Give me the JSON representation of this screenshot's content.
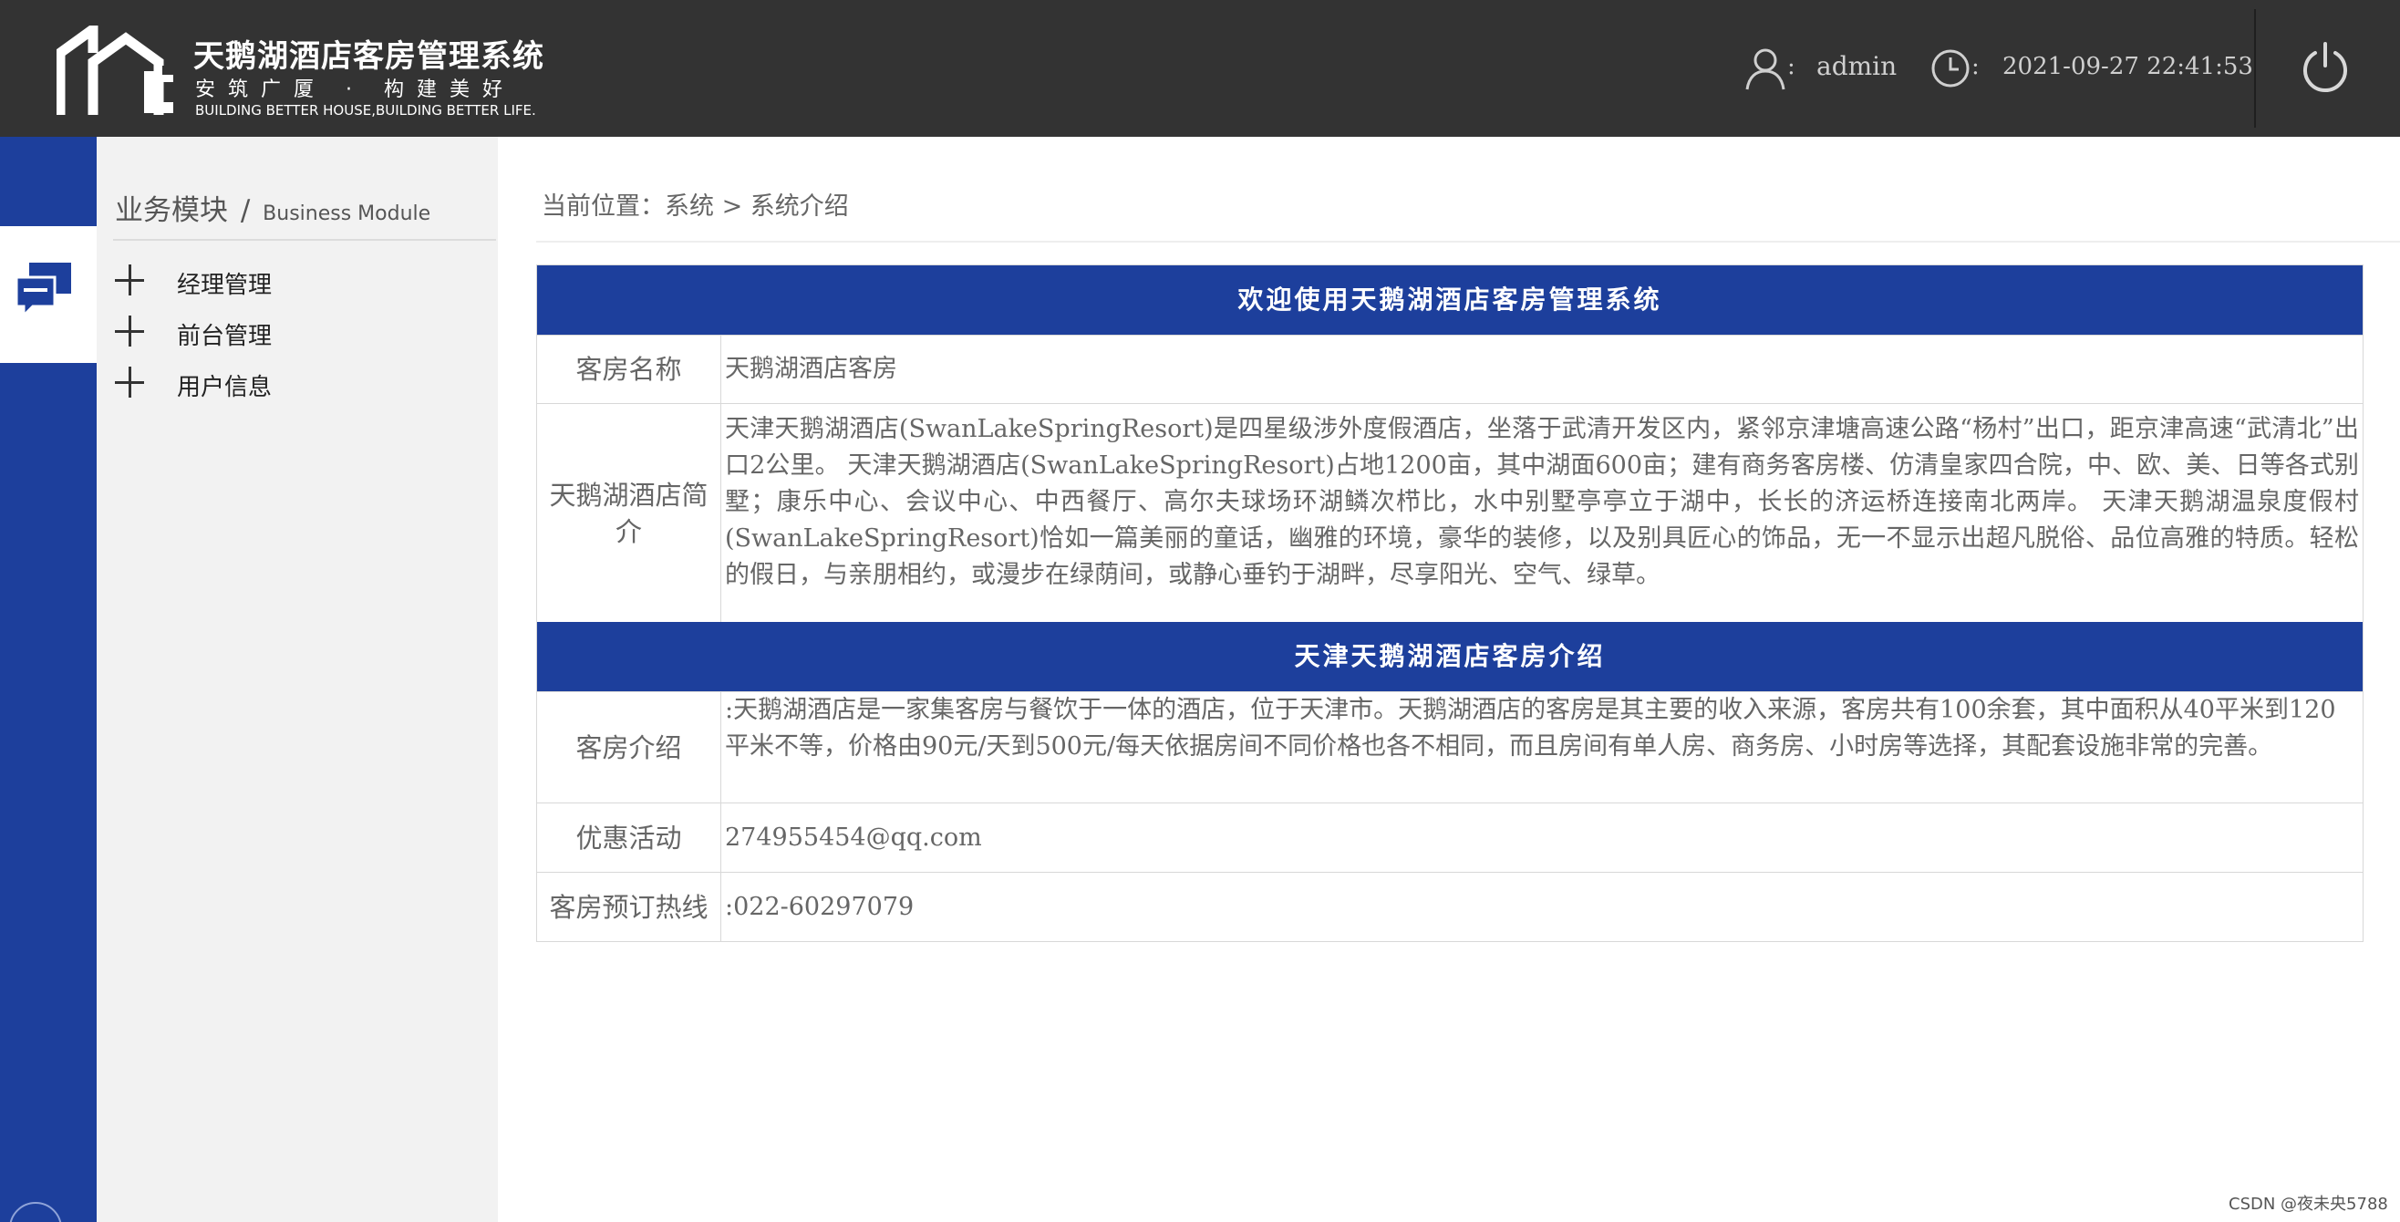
{
  "header": {
    "logo_title": "天鹅湖酒店客房管理系统",
    "logo_slogan": "安筑广厦 · 构建美好",
    "logo_slogan_en": "BUILDING BETTER HOUSE,BUILDING BETTER LIFE.",
    "user_icon": "user-icon",
    "colon": ":",
    "username": "admin",
    "clock_icon": "clock-icon",
    "datetime": "2021-09-27 22:41:53",
    "power_icon": "power-icon"
  },
  "leftbar": {
    "active_icon": "chat-icon"
  },
  "sidebar": {
    "module_title": "业务模块",
    "module_sep": "/",
    "module_title_en": "Business Module",
    "items": [
      {
        "label": "经理管理",
        "icon": "plus-icon"
      },
      {
        "label": "前台管理",
        "icon": "plus-icon"
      },
      {
        "label": "用户信息",
        "icon": "plus-icon"
      }
    ]
  },
  "breadcrumb": "当前位置：系统 > 系统介绍",
  "panel": {
    "welcome_title": "欢迎使用天鹅湖酒店客房管理系统",
    "rows_top": [
      {
        "label": "客房名称",
        "value": "天鹅湖酒店客房"
      },
      {
        "label": "天鹅湖酒店简介",
        "value": "天津天鹅湖酒店(SwanLakeSpringResort)是四星级涉外度假酒店，坐落于武清开发区内，紧邻京津塘高速公路“杨村”出口，距京津高速“武清北”出口2公里。 天津天鹅湖酒店(SwanLakeSpringResort)占地1200亩，其中湖面600亩；建有商务客房楼、仿清皇家四合院，中、欧、美、日等各式别墅；康乐中心、会议中心、中西餐厅、高尔夫球场环湖鳞次栉比，水中别墅亭亭立于湖中，长长的济运桥连接南北两岸。 天津天鹅湖温泉度假村(SwanLakeSpringResort)恰如一篇美丽的童话，幽雅的环境，豪华的装修，以及别具匠心的饰品，无一不显示出超凡脱俗、品位高雅的特质。轻松的假日，与亲朋相约，或漫步在绿荫间，或静心垂钓于湖畔，尽享阳光、空气、绿草。"
      }
    ],
    "section_title": "天津天鹅湖酒店客房介绍",
    "rows_bottom": [
      {
        "label": "客房介绍",
        "value": ":天鹅湖酒店是一家集客房与餐饮于一体的酒店，位于天津市。天鹅湖酒店的客房是其主要的收入来源，客房共有100余套，其中面积从40平米到120平米不等，价格由90元/天到500元/每天依据房间不同价格也各不相同，而且房间有单人房、商务房、小时房等选择，其配套设施非常的完善。"
      },
      {
        "label": "优惠活动",
        "value": "274955454@qq.com"
      },
      {
        "label": "客房预订热线",
        "value": ":022-60297079"
      }
    ]
  },
  "watermark": "CSDN @夜未央5788",
  "colors": {
    "header_bg": "#333333",
    "accent_blue": "#1d3f9c",
    "sidebar_bg": "#f2f2f2"
  }
}
